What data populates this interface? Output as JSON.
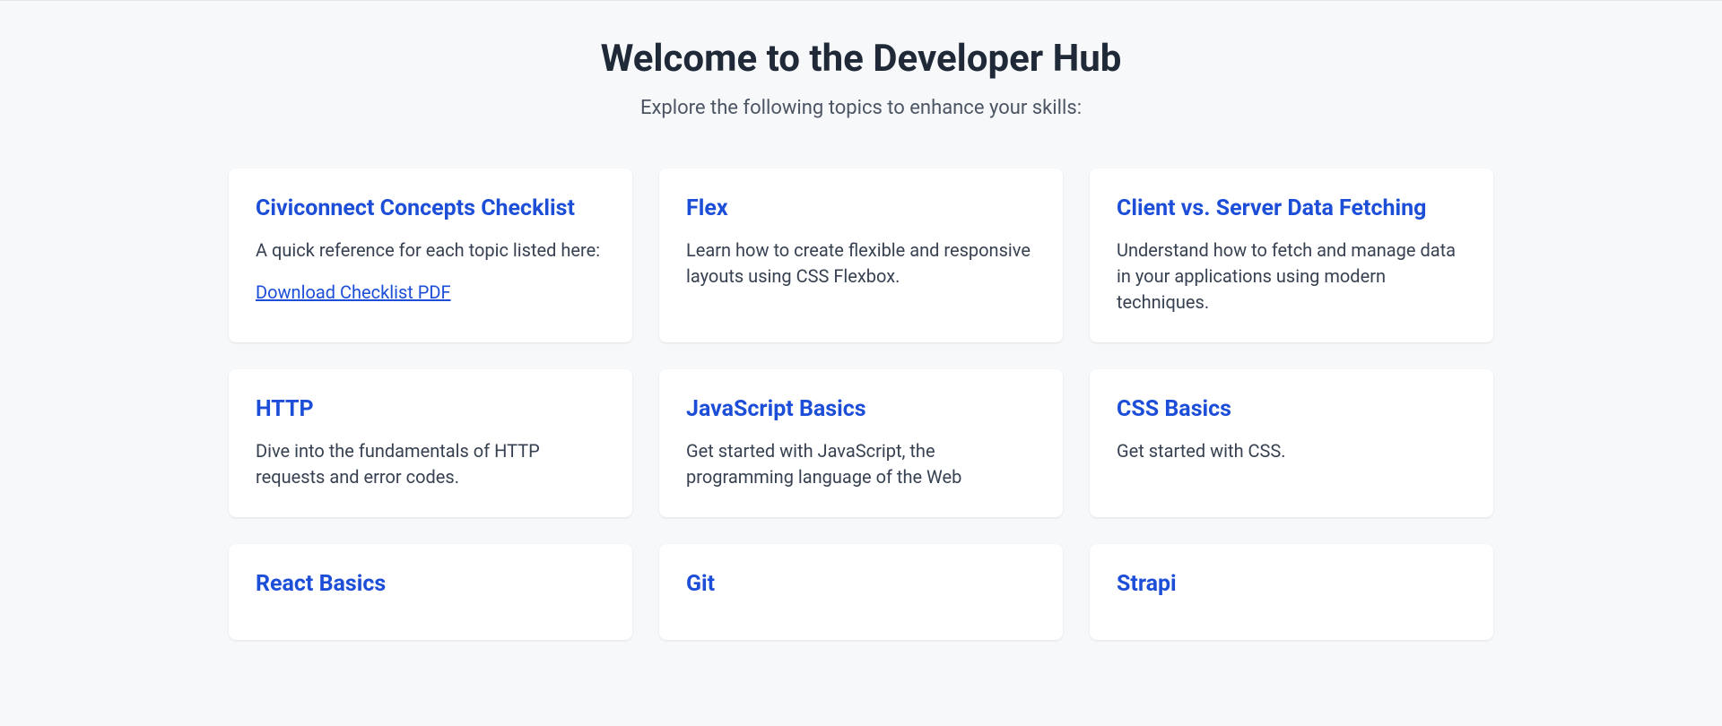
{
  "header": {
    "title": "Welcome to the Developer Hub",
    "subtitle": "Explore the following topics to enhance your skills:"
  },
  "cards": [
    {
      "title": "Civiconnect Concepts Checklist",
      "description": "A quick reference for each topic listed here:",
      "link_label": "Download Checklist PDF"
    },
    {
      "title": "Flex",
      "description": "Learn how to create flexible and responsive layouts using CSS Flexbox."
    },
    {
      "title": "Client vs. Server Data Fetching",
      "description": "Understand how to fetch and manage data in your applications using modern techniques."
    },
    {
      "title": "HTTP",
      "description": "Dive into the fundamentals of HTTP requests and error codes."
    },
    {
      "title": "JavaScript Basics",
      "description": "Get started with JavaScript, the programming language of the Web"
    },
    {
      "title": "CSS Basics",
      "description": "Get started with CSS."
    },
    {
      "title": "React Basics",
      "description": ""
    },
    {
      "title": "Git",
      "description": ""
    },
    {
      "title": "Strapi",
      "description": ""
    }
  ]
}
